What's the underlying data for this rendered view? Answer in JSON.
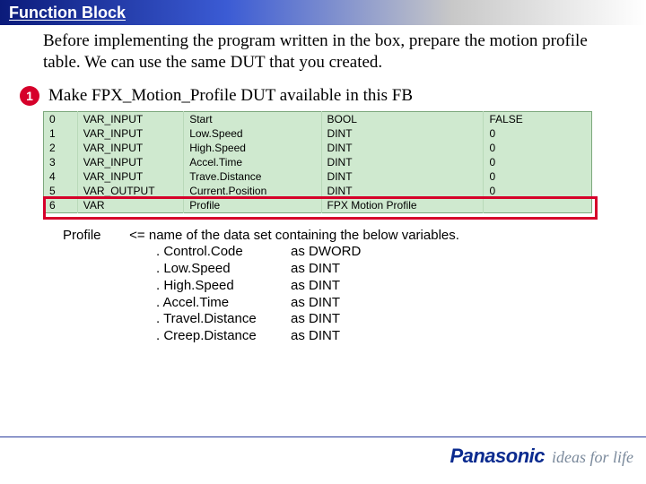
{
  "header": {
    "title": "Function Block"
  },
  "intro": "Before implementing the program written in the box, prepare the motion profile table.  We can use the same DUT that you created.",
  "step": {
    "number": "1",
    "text": "Make FPX_Motion_Profile DUT available in this FB"
  },
  "var_table": {
    "rows": [
      {
        "idx": "0",
        "class": "VAR_INPUT",
        "name": "Start",
        "type": "BOOL",
        "init": "FALSE"
      },
      {
        "idx": "1",
        "class": "VAR_INPUT",
        "name": "Low.Speed",
        "type": "DINT",
        "init": "0"
      },
      {
        "idx": "2",
        "class": "VAR_INPUT",
        "name": "High.Speed",
        "type": "DINT",
        "init": "0"
      },
      {
        "idx": "3",
        "class": "VAR_INPUT",
        "name": "Accel.Time",
        "type": "DINT",
        "init": "0"
      },
      {
        "idx": "4",
        "class": "VAR_INPUT",
        "name": "Trave.Distance",
        "type": "DINT",
        "init": "0"
      },
      {
        "idx": "5",
        "class": "VAR_OUTPUT",
        "name": "Current.Position",
        "type": "DINT",
        "init": "0"
      },
      {
        "idx": "6",
        "class": "VAR",
        "name": "Profile",
        "type": "FPX Motion Profile",
        "init": ""
      }
    ]
  },
  "desc": {
    "label": "Profile",
    "lead": "<= name of the data set containing the below variables.",
    "members": [
      {
        "name": ". Control.Code",
        "type": "as DWORD"
      },
      {
        "name": ". Low.Speed",
        "type": "as DINT"
      },
      {
        "name": ". High.Speed",
        "type": "as DINT"
      },
      {
        "name": ". Accel.Time",
        "type": "as DINT"
      },
      {
        "name": ". Travel.Distance",
        "type": "as DINT"
      },
      {
        "name": ". Creep.Distance",
        "type": "as DINT"
      }
    ]
  },
  "footer": {
    "brand": "Panasonic",
    "tagline": "ideas for life"
  }
}
